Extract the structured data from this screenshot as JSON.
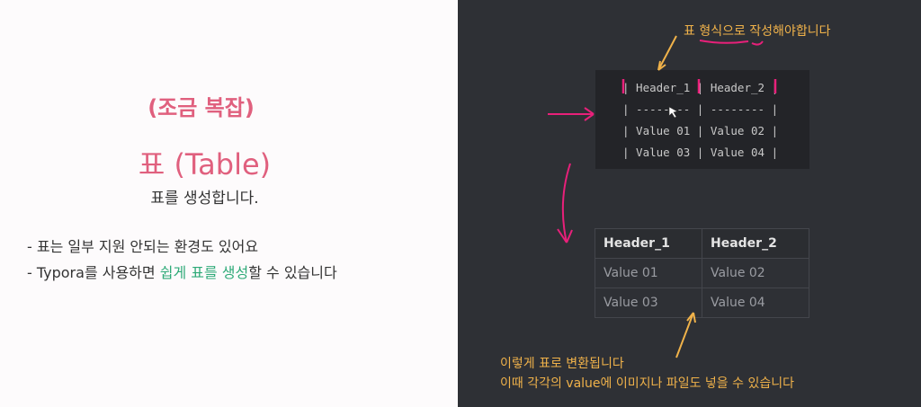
{
  "slide": {
    "subtitle": "(조금 복잡)",
    "title": "표 (Table)",
    "description": "표를 생성합니다.",
    "bullets": [
      {
        "text": "- 표는 일부 지원 안되는 환경도 있어요"
      },
      {
        "prefix": "- Typora를 사용하면 ",
        "highlight": "쉽게 표를 생성",
        "suffix": "할 수 있습니다"
      }
    ]
  },
  "markdown_lines": [
    "| Header_1 | Header_2 |",
    "| -------- | -------- |",
    "| Value 01 | Value 02 |",
    "| Value 03 | Value 04 |"
  ],
  "rendered_table": {
    "headers": [
      "Header_1",
      "Header_2"
    ],
    "rows": [
      [
        "Value 01",
        "Value 02"
      ],
      [
        "Value 03",
        "Value 04"
      ]
    ]
  },
  "annotations": {
    "top_note": "표 형식으로 작성해야합니다",
    "bottom_note_1": "이렇게 표로 변환됩니다",
    "bottom_note_2": "이때 각각의 value에 이미지나 파일도 넣을 수 있습니다"
  },
  "colors": {
    "accent_pink": "#e0607e",
    "highlight_green": "#2eaa78",
    "annotation_orange": "#f0b24a",
    "marker_magenta": "#e8207a",
    "dark_panel": "#2e3035"
  }
}
